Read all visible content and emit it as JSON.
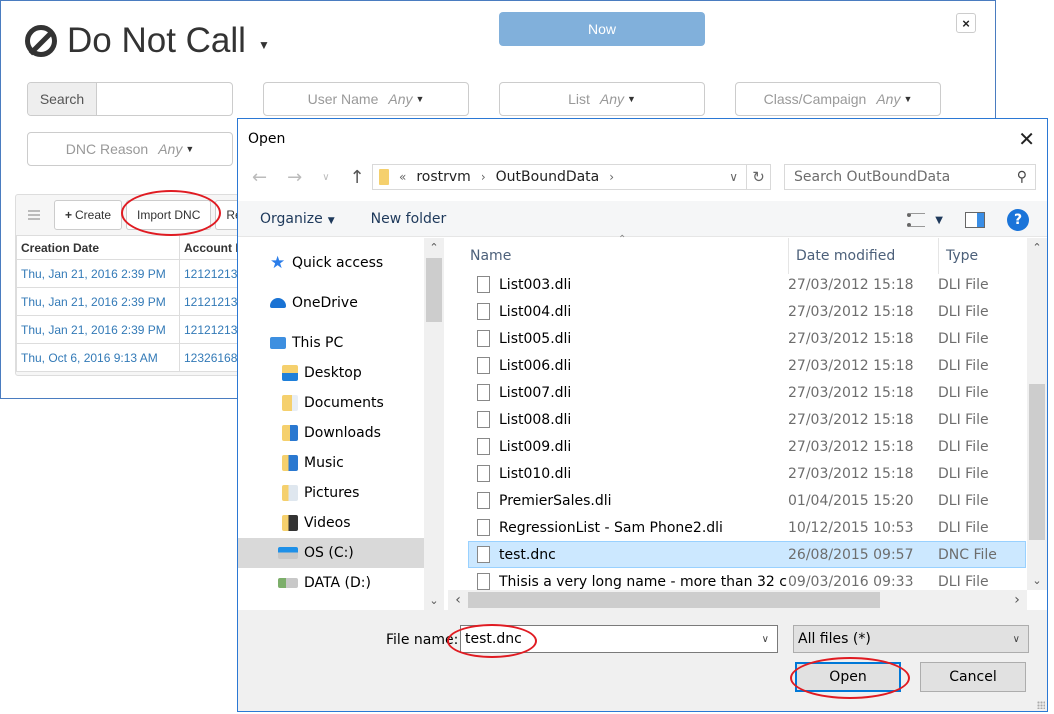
{
  "app": {
    "title": "Do Not Call",
    "now_button": "Now",
    "close_label": "×",
    "search": {
      "label": "Search",
      "value": ""
    },
    "filters": [
      {
        "label": "User Name",
        "value": "Any"
      },
      {
        "label": "List",
        "value": "Any"
      },
      {
        "label": "Class/Campaign",
        "value": "Any"
      },
      {
        "label": "DNC Reason",
        "value": "Any"
      }
    ],
    "toolbar": {
      "create": "Create",
      "import": "Import DNC",
      "third_partial": "Re"
    },
    "grid": {
      "columns": [
        "Creation Date",
        "Account I"
      ],
      "rows": [
        [
          "Thu, Jan 21, 2016 2:39 PM",
          "12121213"
        ],
        [
          "Thu, Jan 21, 2016 2:39 PM",
          "12121213"
        ],
        [
          "Thu, Jan 21, 2016 2:39 PM",
          "12121213"
        ],
        [
          "Thu, Oct 6, 2016 9:13 AM",
          "12326168"
        ]
      ]
    }
  },
  "dialog": {
    "title": "Open",
    "close": "✕",
    "address": {
      "overflow": "«",
      "crumbs": [
        "rostrvm",
        "OutBoundData"
      ]
    },
    "search_placeholder": "Search OutBoundData",
    "commands": {
      "organize": "Organize",
      "new_folder": "New folder"
    },
    "nav": [
      {
        "label": "Quick access",
        "icon": "star-icon"
      },
      {
        "label": "OneDrive",
        "icon": "cloud-icon"
      },
      {
        "label": "This PC",
        "icon": "computer-icon"
      },
      {
        "label": "Desktop",
        "icon": "desktop-folder-icon"
      },
      {
        "label": "Documents",
        "icon": "documents-folder-icon"
      },
      {
        "label": "Downloads",
        "icon": "downloads-folder-icon"
      },
      {
        "label": "Music",
        "icon": "music-folder-icon"
      },
      {
        "label": "Pictures",
        "icon": "pictures-folder-icon"
      },
      {
        "label": "Videos",
        "icon": "videos-folder-icon"
      },
      {
        "label": "OS (C:)",
        "icon": "drive-icon",
        "selected": true
      },
      {
        "label": "DATA (D:)",
        "icon": "drive-icon"
      }
    ],
    "columns": {
      "name": "Name",
      "date": "Date modified",
      "type": "Type"
    },
    "files": [
      {
        "name": "List003.dli",
        "date": "27/03/2012 15:18",
        "type": "DLI File"
      },
      {
        "name": "List004.dli",
        "date": "27/03/2012 15:18",
        "type": "DLI File"
      },
      {
        "name": "List005.dli",
        "date": "27/03/2012 15:18",
        "type": "DLI File"
      },
      {
        "name": "List006.dli",
        "date": "27/03/2012 15:18",
        "type": "DLI File"
      },
      {
        "name": "List007.dli",
        "date": "27/03/2012 15:18",
        "type": "DLI File"
      },
      {
        "name": "List008.dli",
        "date": "27/03/2012 15:18",
        "type": "DLI File"
      },
      {
        "name": "List009.dli",
        "date": "27/03/2012 15:18",
        "type": "DLI File"
      },
      {
        "name": "List010.dli",
        "date": "27/03/2012 15:18",
        "type": "DLI File"
      },
      {
        "name": "PremierSales.dli",
        "date": "01/04/2015 15:20",
        "type": "DLI File"
      },
      {
        "name": "RegressionList - Sam Phone2.dli",
        "date": "10/12/2015 10:53",
        "type": "DLI File"
      },
      {
        "name": "test.dnc",
        "date": "26/08/2015 09:57",
        "type": "DNC File",
        "selected": true
      },
      {
        "name": "Thisis a very long name - more than 32 c...",
        "date": "09/03/2016 09:33",
        "type": "DLI File"
      }
    ],
    "file_name_label": "File name:",
    "file_name_value": "test.dnc",
    "file_type": "All files (*)",
    "open_button": "Open",
    "cancel_button": "Cancel"
  },
  "colors": {
    "accent": "#0078d7",
    "selection": "#cce8ff",
    "link": "#337ab7",
    "now_button": "#81b0db",
    "annotation": "#e01b22"
  }
}
